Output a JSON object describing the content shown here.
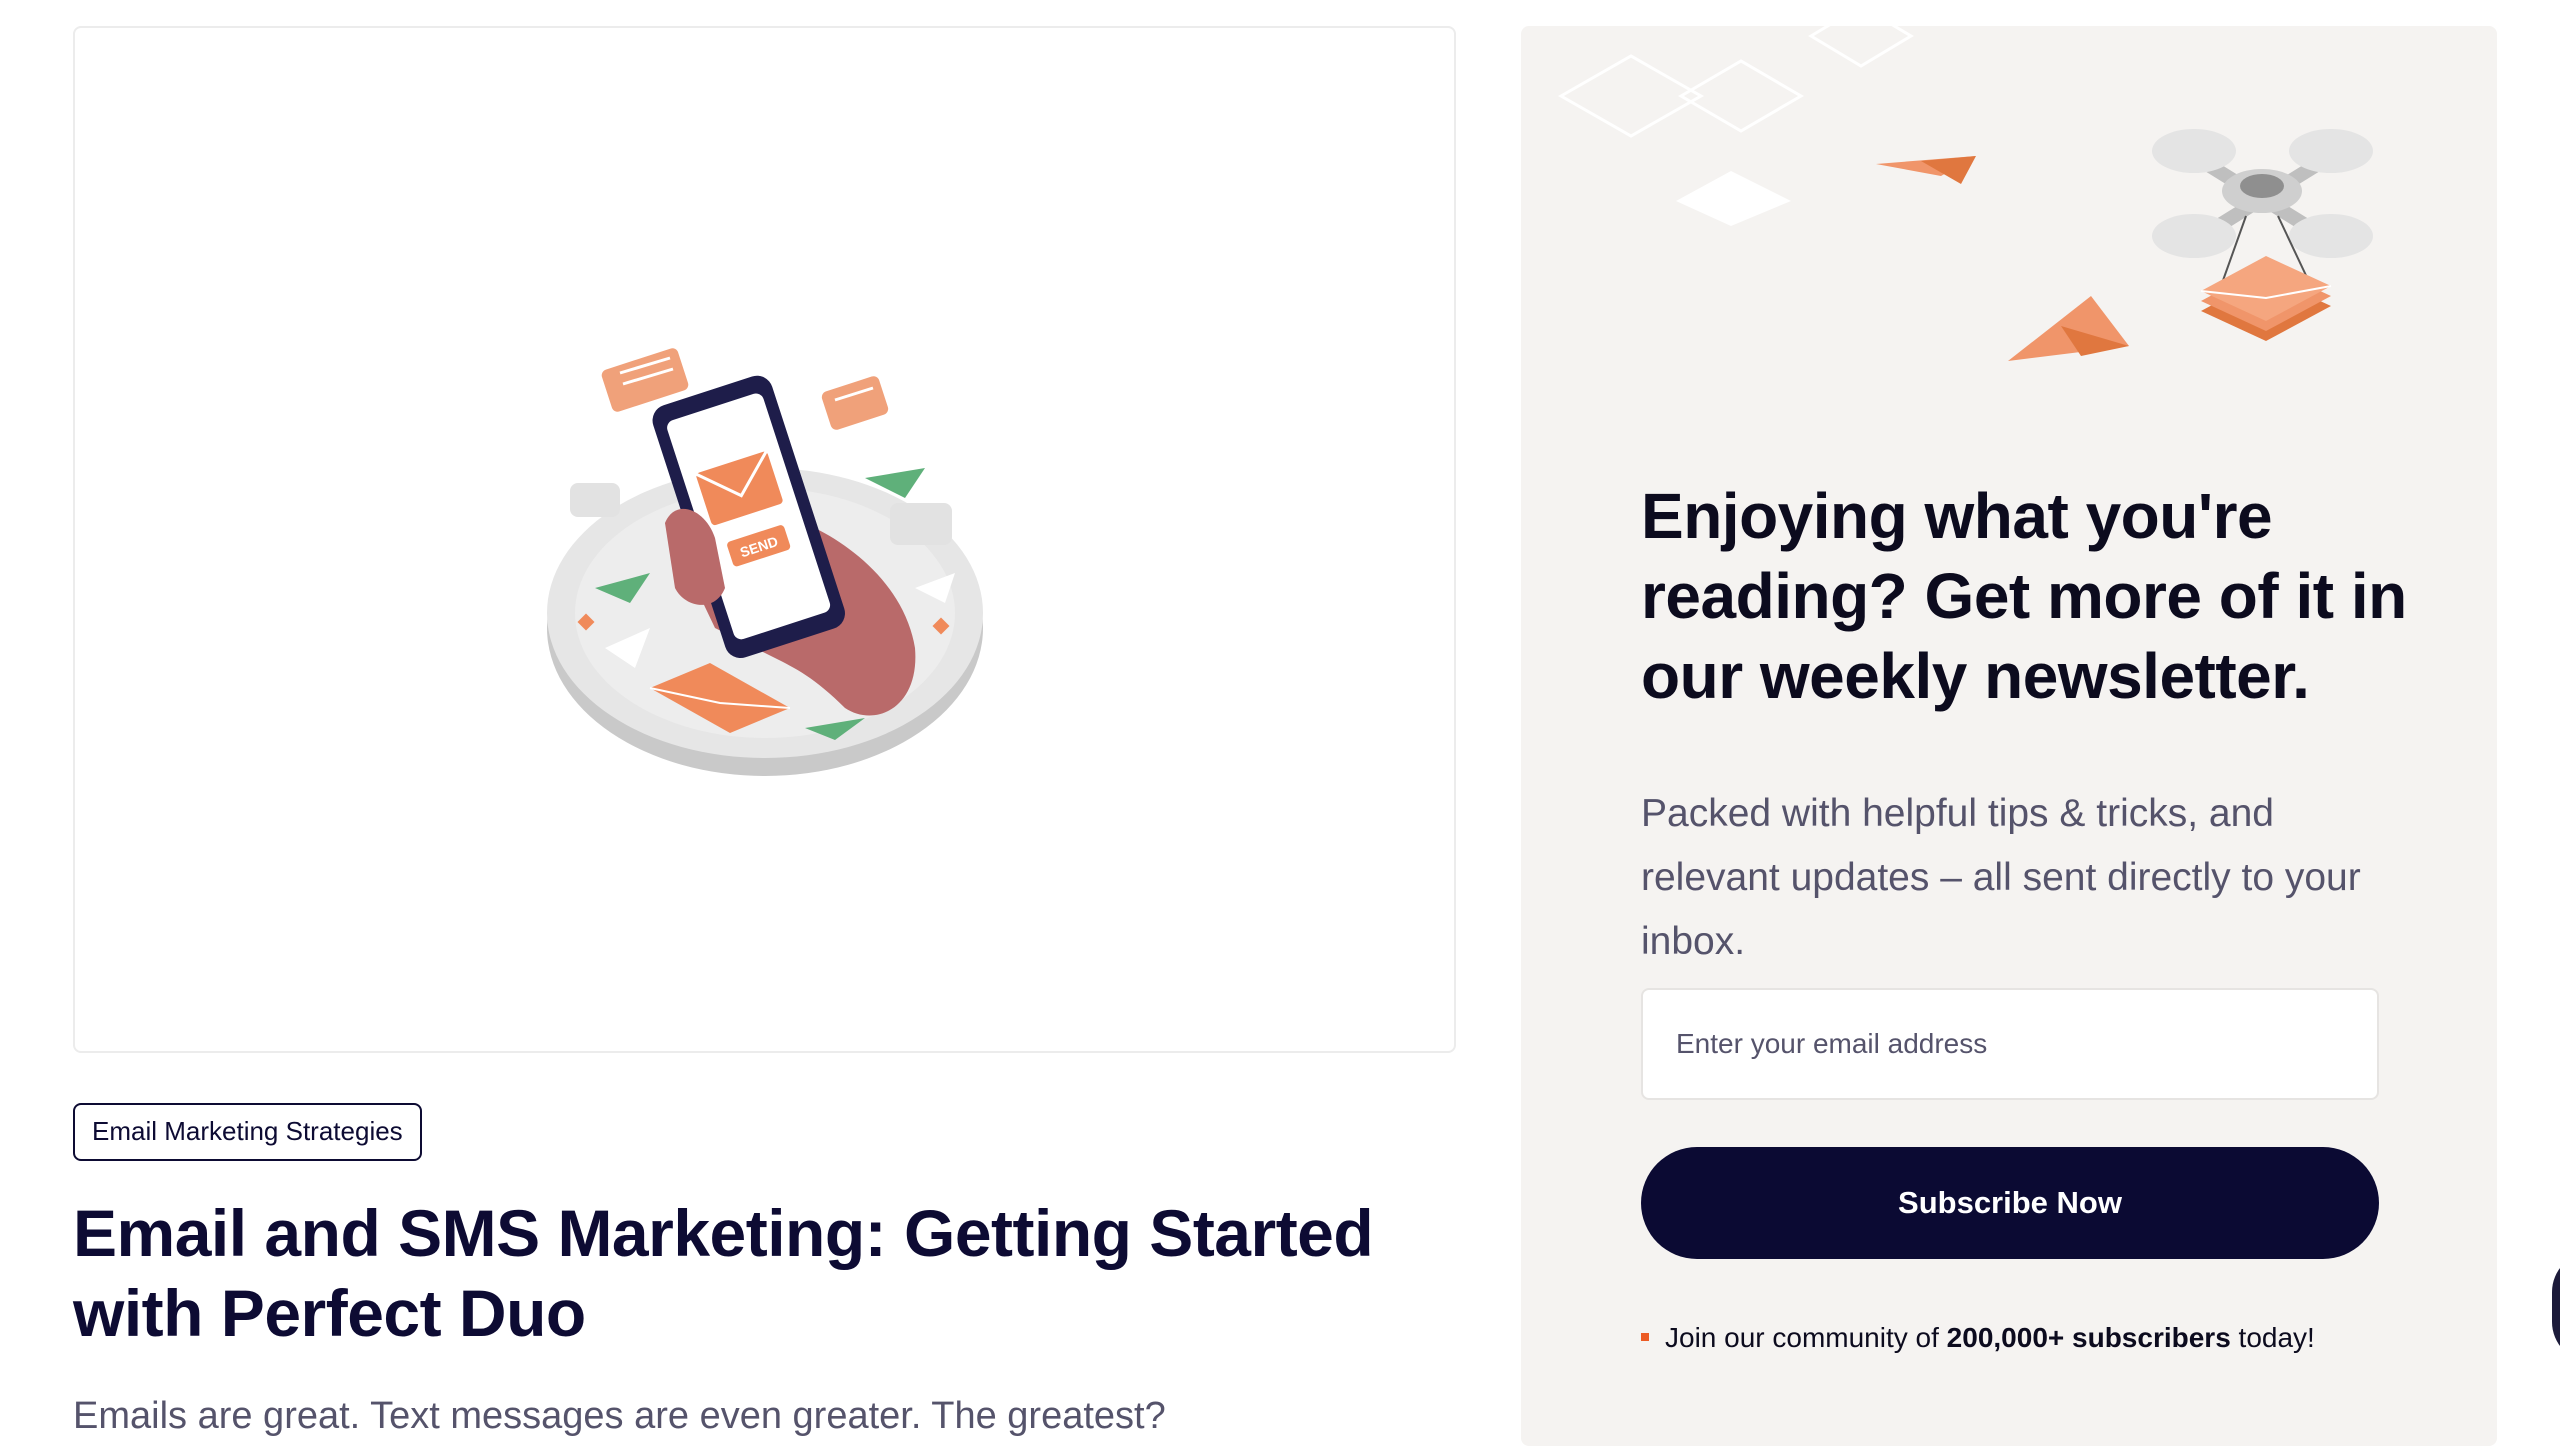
{
  "article": {
    "category": "Email Marketing Strategies",
    "title": "Email and SMS Marketing: Getting Started with Perfect Duo",
    "excerpt": "Emails are great. Text messages are even greater. The greatest?",
    "illustration_send_label": "SEND"
  },
  "newsletter": {
    "heading": "Enjoying what you're reading? Get more of it in our weekly newsletter.",
    "description": "Packed with helpful tips & tricks, and relevant updates – all sent directly to your inbox.",
    "email_placeholder": "Enter your email address",
    "subscribe_label": "Subscribe Now",
    "community_prefix": "Join our community of ",
    "community_count": "200,000+ subscribers",
    "community_suffix": " today!"
  },
  "colors": {
    "brand_navy": "#0b0a33",
    "accent_orange": "#ec5b24",
    "panel_background": "#f5f3f1",
    "illustration_orange": "#f0956a",
    "illustration_green": "#5fb07a"
  },
  "icons": {
    "article_image": "hand-phone-send-illustration",
    "newsletter_art": "drone-paper-plane-illustration",
    "chat_widget": "chat-bubble-icon"
  }
}
